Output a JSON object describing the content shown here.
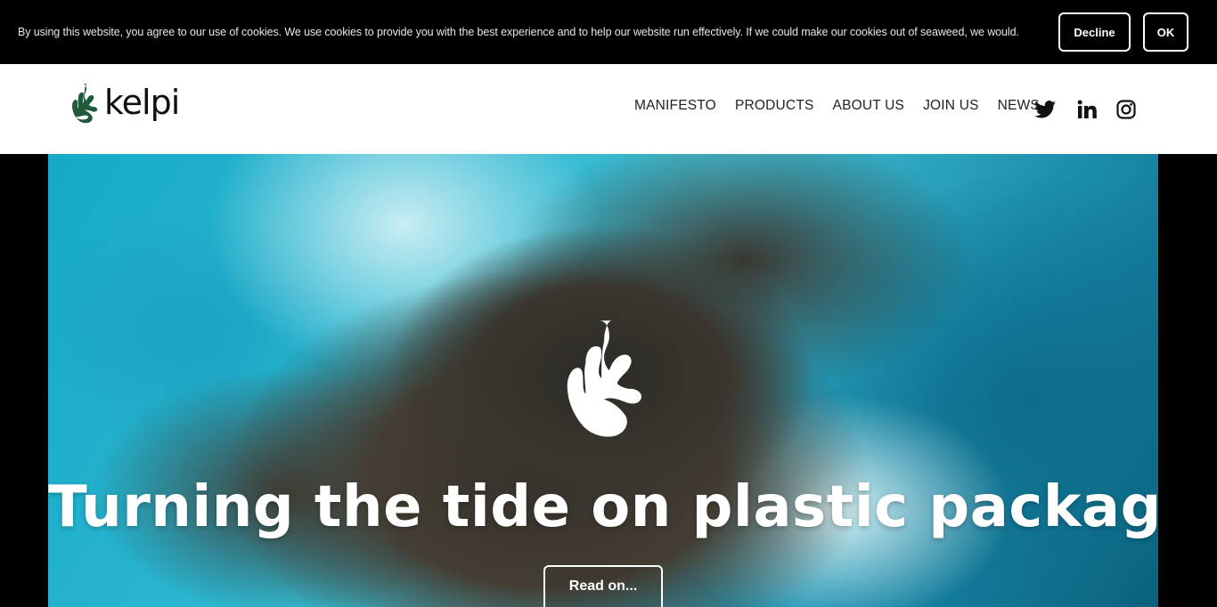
{
  "cookie_bar": {
    "message": "By using this website, you agree to our use of cookies. We use cookies to provide you with the best experience and to help our website run effectively. If we could make our cookies out of seaweed, we would.",
    "decline_label": "Decline",
    "ok_label": "OK"
  },
  "header": {
    "logo_text": "kelpi",
    "brand_color": "#1f5a3a",
    "nav": [
      {
        "label": "MANIFESTO"
      },
      {
        "label": "PRODUCTS"
      },
      {
        "label": "ABOUT US"
      },
      {
        "label": "JOIN US"
      },
      {
        "label": "NEWS"
      }
    ],
    "social": [
      "twitter-icon",
      "linkedin-icon",
      "instagram-icon"
    ]
  },
  "hero": {
    "title": "Turning the tide on plastic packaging",
    "cta_label": "Read on..."
  }
}
